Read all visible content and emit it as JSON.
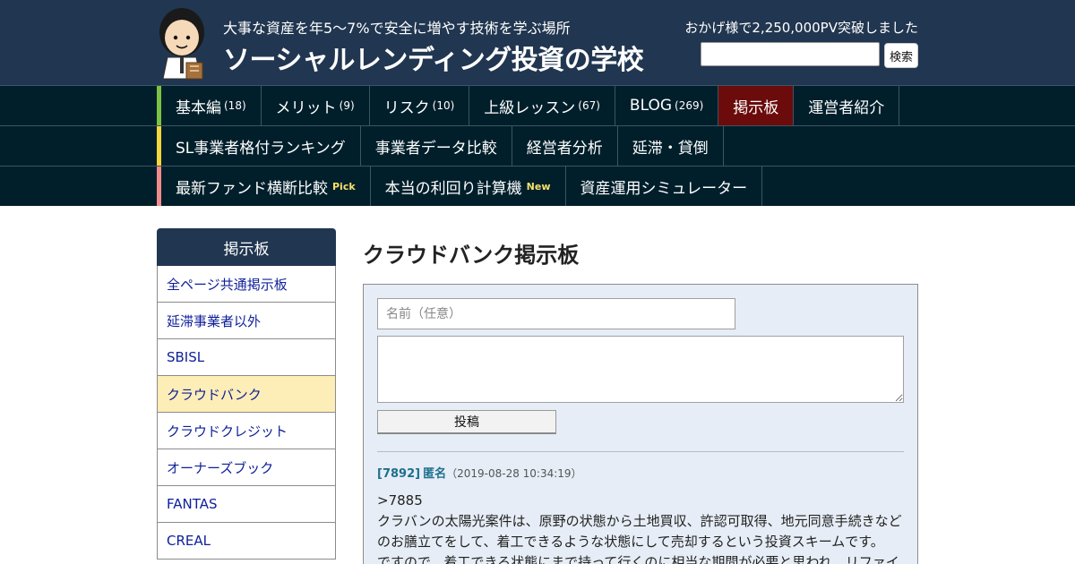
{
  "header": {
    "tagline": "大事な資産を年5～7%で安全に増やす技術を学ぶ場所",
    "title": "ソーシャルレンディング投資の学校",
    "pv_notice": "おかげ様で2,250,000PV突破しました",
    "search_button": "検索",
    "search_value": ""
  },
  "nav": {
    "row1": [
      {
        "label": "基本編",
        "count": "(18)"
      },
      {
        "label": "メリット",
        "count": "(9)"
      },
      {
        "label": "リスク",
        "count": "(10)"
      },
      {
        "label": "上級レッスン",
        "count": "(67)"
      },
      {
        "label": "BLOG",
        "count": "(269)"
      },
      {
        "label": "掲示板",
        "count": ""
      },
      {
        "label": "運営者紹介",
        "count": ""
      }
    ],
    "row2": [
      {
        "label": "SL事業者格付ランキング"
      },
      {
        "label": "事業者データ比較"
      },
      {
        "label": "経営者分析"
      },
      {
        "label": "延滞・貸倒"
      }
    ],
    "row3": [
      {
        "label": "最新ファンド横断比較",
        "tag": "Pick"
      },
      {
        "label": "本当の利回り計算機",
        "tag": "New"
      },
      {
        "label": "資産運用シミュレーター",
        "tag": ""
      }
    ],
    "strip_colors": [
      "#7cc242",
      "#f5d43c",
      "#f28c8c"
    ],
    "active_color": "#6b0b0b"
  },
  "sidebar": {
    "title": "掲示板",
    "items": [
      {
        "label": "全ページ共通掲示板"
      },
      {
        "label": "延滞事業者以外"
      },
      {
        "label": "SBISL"
      },
      {
        "label": "クラウドバンク"
      },
      {
        "label": "クラウドクレジット"
      },
      {
        "label": "オーナーズブック"
      },
      {
        "label": "FANTAS"
      },
      {
        "label": "CREAL"
      }
    ]
  },
  "main": {
    "title": "クラウドバンク掲示板",
    "form": {
      "name_placeholder": "名前（任意）",
      "name_value": "",
      "body_value": "",
      "submit_label": "投稿"
    },
    "posts": [
      {
        "number": "[7892]",
        "author": "匿名",
        "date": "（2019-08-28 10:34:19）",
        "lines": [
          ">7885",
          "クラバンの太陽光案件は、原野の状態から土地買収、許認可取得、地元同意手続きなどのお膳立てをして、着工できるような状態にして売却するという投資スキームです。",
          "ですので、着工できる状態にまで持って行くのに相当な期間が必要と思われ、リファイ"
        ]
      }
    ]
  }
}
